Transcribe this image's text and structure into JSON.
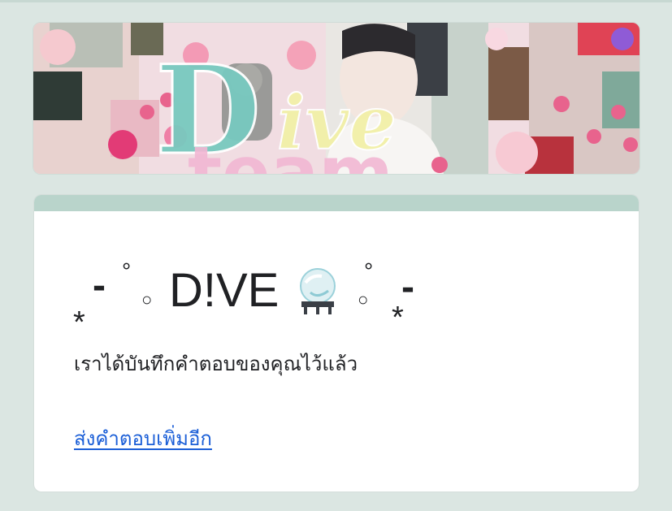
{
  "banner": {
    "headline": "Dive",
    "subline": "team"
  },
  "form": {
    "title": "D!VE",
    "title_prefix": "-",
    "title_suffix": "-",
    "confirmation_message": "เราได้บันทึกคำตอบของคุณไว้แล้ว",
    "submit_another_link": "ส่งคำตอบเพิ่มอีก"
  },
  "colors": {
    "page_background": "#dbe6e2",
    "card_accent": "#b9d4cb",
    "link": "#1a5ed7",
    "text": "#202124"
  },
  "icons": [
    "crystal-ball-icon"
  ]
}
